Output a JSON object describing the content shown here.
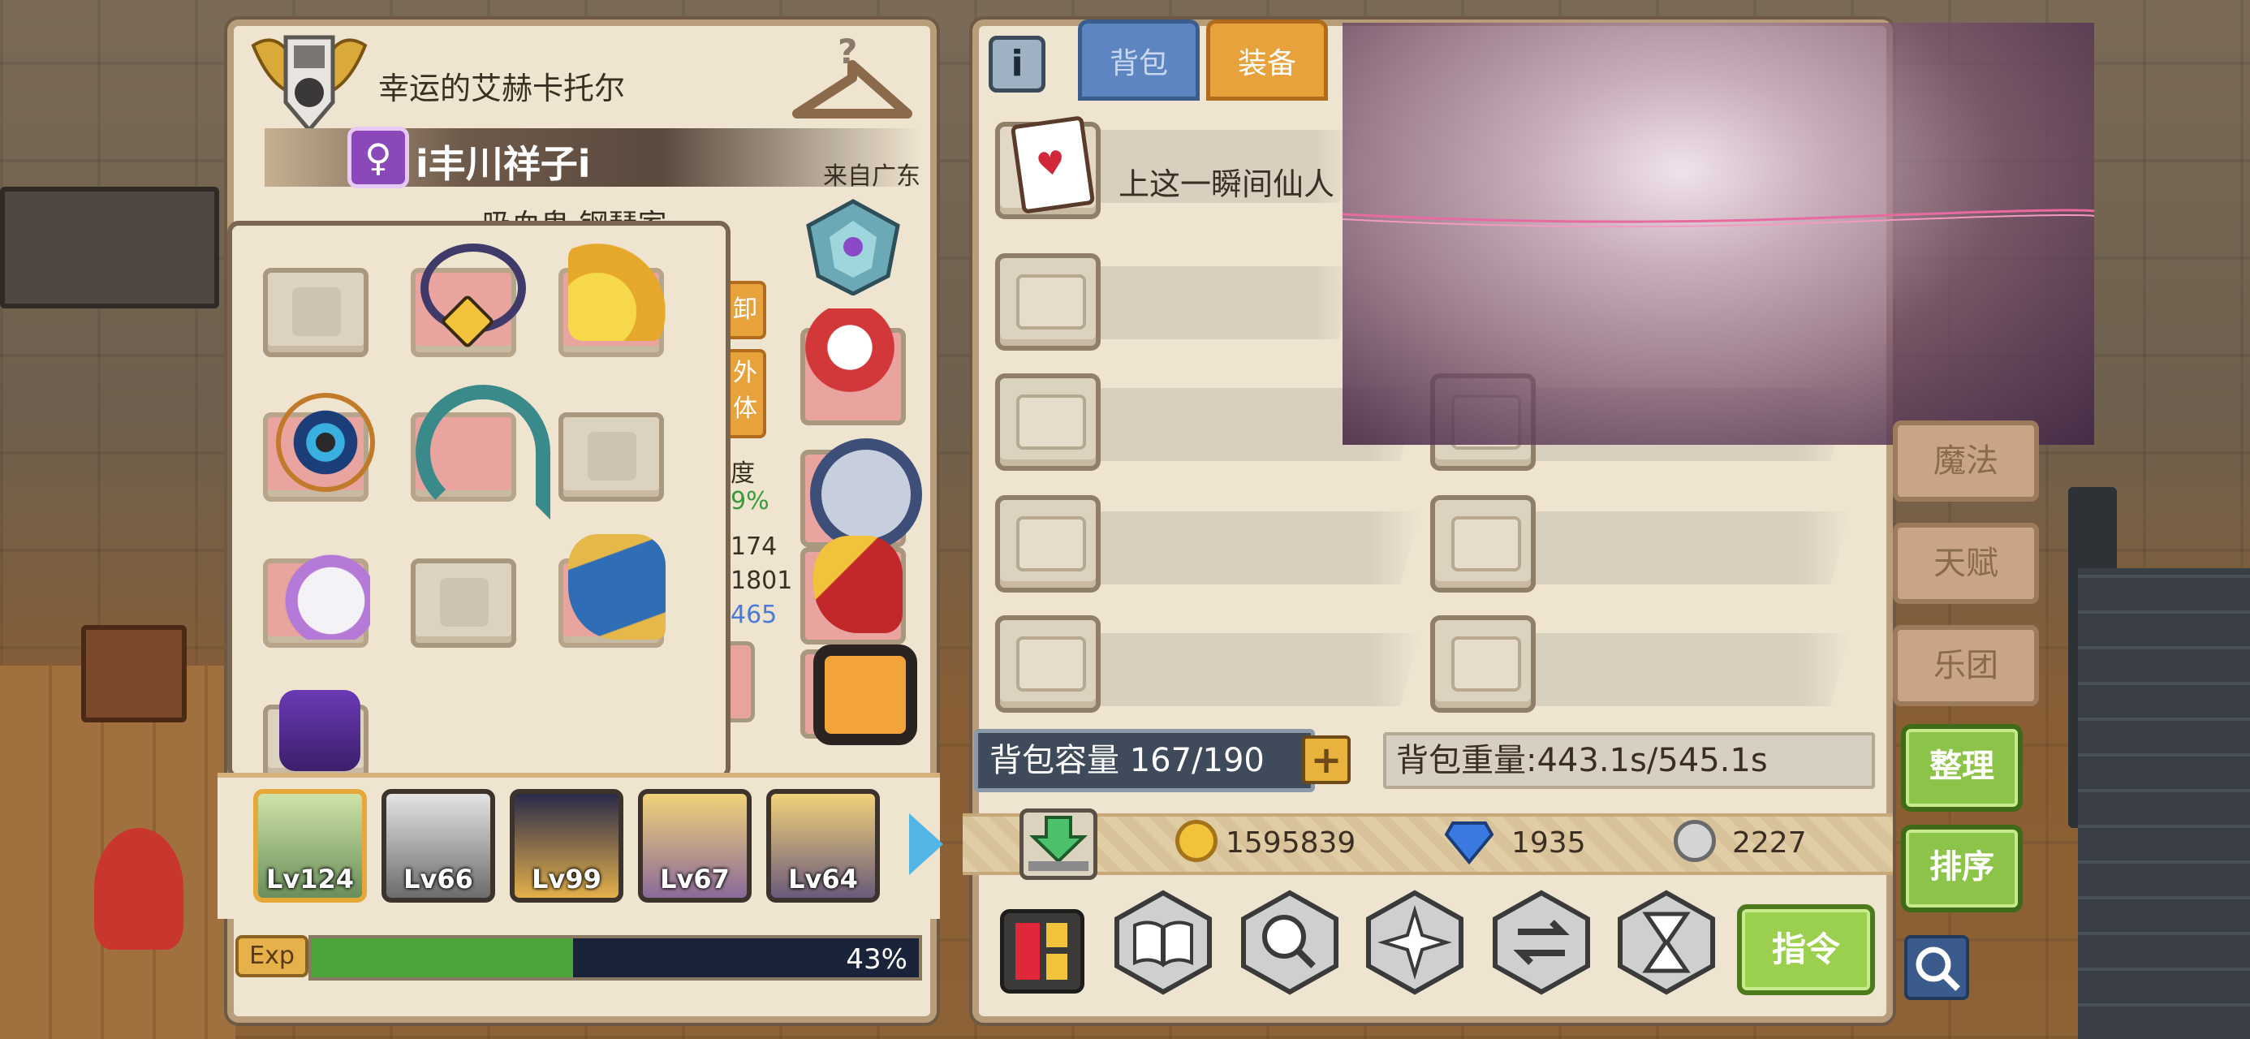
{
  "character": {
    "title": "幸运的艾赫卡托尔",
    "gender_symbol": "♀",
    "name": "i丰川祥子i",
    "origin": "来自广东",
    "subtitle": "吸血鬼 钢琴家"
  },
  "side_buttons": {
    "unequip": "卸",
    "outfit_line1": "外",
    "outfit_line2": "体"
  },
  "stats": {
    "label_partial": "度",
    "percent_partial": "9%",
    "val1": "174",
    "val2": "1801",
    "val3": "465"
  },
  "team": [
    {
      "level": "Lv124",
      "selected": true
    },
    {
      "level": "Lv66",
      "selected": false
    },
    {
      "level": "Lv99",
      "selected": false
    },
    {
      "level": "Lv67",
      "selected": false
    },
    {
      "level": "Lv64",
      "selected": false
    }
  ],
  "exp": {
    "label": "Exp",
    "percent": 43,
    "percent_text": "43%"
  },
  "inventory": {
    "info_label": "i",
    "tab_bag": "背包",
    "tab_equip": "装备",
    "first_item_text": "上这一瞬间仙人",
    "capacity_text": "背包容量 167/190",
    "plus_label": "+",
    "weight_text": "背包重量:443.1s/545.1s"
  },
  "currency": {
    "gold": "1595839",
    "diamond": "1935",
    "silver": "2227"
  },
  "actions": {
    "command_label": "指令",
    "icons": [
      "book-icon",
      "magnifier-icon",
      "compass-icon",
      "swap-icon",
      "hourglass-icon"
    ]
  },
  "side_menu": {
    "magic": "魔法",
    "talent": "天赋",
    "band": "乐团",
    "organize": "整理",
    "sort": "排序"
  },
  "colors": {
    "parchment": "#efe4d0",
    "tab_active": "#e8a23c",
    "tab_inactive": "#5d85c2",
    "exp_fill": "#4ca63c",
    "green_button": "#8cc44a"
  }
}
